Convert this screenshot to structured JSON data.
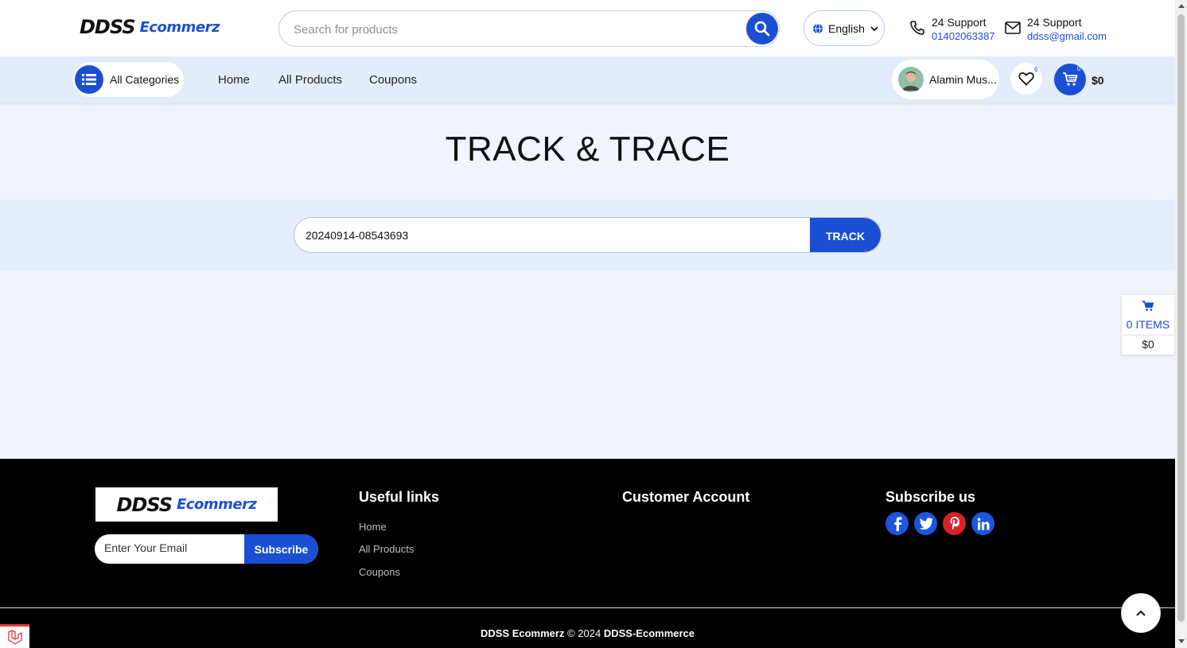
{
  "header": {
    "logo_main": "DDSS",
    "logo_sub": "Ecommerz",
    "search_placeholder": "Search for products",
    "language": "English",
    "phone_support": {
      "label": "24 Support",
      "value": "01402063387"
    },
    "email_support": {
      "label": "24 Support",
      "value": "ddss@gmail.com"
    }
  },
  "nav": {
    "categories_label": "All Categories",
    "links": [
      "Home",
      "All Products",
      "Coupons"
    ],
    "user_name": "Alamin Mus...",
    "wishlist_count": "6",
    "cart_count": "0",
    "cart_total": "$0"
  },
  "main": {
    "title": "TRACK & TRACE",
    "tracking_code": "20240914-08543693",
    "track_button": "TRACK"
  },
  "side_cart": {
    "items": "0 ITEMS",
    "total": "$0"
  },
  "footer": {
    "email_placeholder": "Enter Your Email",
    "subscribe_button": "Subscribe",
    "useful_links_heading": "Useful links",
    "useful_links": [
      "Home",
      "All Products",
      "Coupons"
    ],
    "customer_account_heading": "Customer Account",
    "subscribe_heading": "Subscribe us",
    "social": [
      "facebook-icon",
      "twitter-icon",
      "pinterest-icon",
      "linkedin-icon"
    ],
    "copyright_brand": "DDSS Ecommerz",
    "copyright_middle": "© 2024",
    "copyright_site": "DDSS-Ecommerce"
  },
  "colors": {
    "accent": "#1b4fd3",
    "nav_bg": "#e3ecfb",
    "page_bg": "#f1f4fd",
    "footer_bg": "#000000"
  }
}
